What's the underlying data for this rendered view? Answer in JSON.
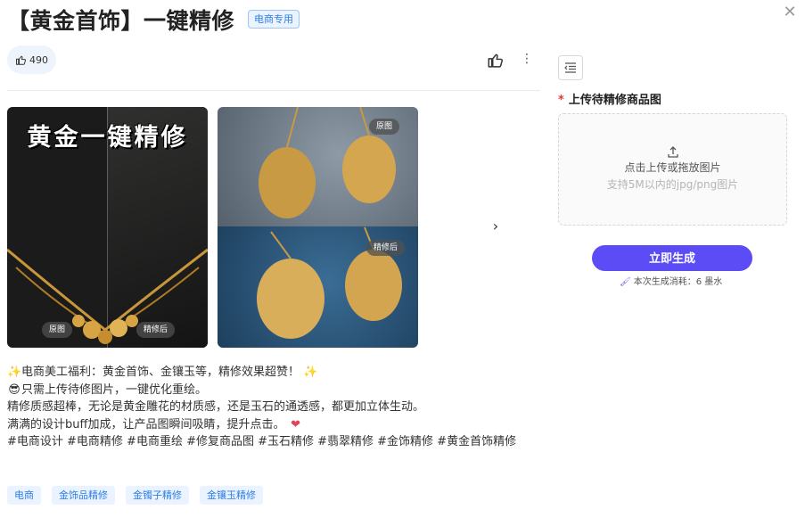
{
  "header": {
    "title": "【黄金首饰】一键精修",
    "badge": "电商专用",
    "close_icon": "close-icon"
  },
  "actions": {
    "like_count": "490",
    "like_icon": "thumbs-up-icon",
    "more_icon": "more-vertical-icon"
  },
  "gallery": {
    "image1": {
      "title": "黄金一键精修",
      "label_before": "原图",
      "label_after": "精修后"
    },
    "image2": {
      "label_before": "原图",
      "label_after": "精修后"
    },
    "next_icon": "chevron-right-icon"
  },
  "description": {
    "line1": "电商美工福利：黄金首饰、金镶玉等，精修效果超赞！",
    "line2": "只需上传待修图片，一键优化重绘。",
    "line3": "精修质感超棒，无论是黄金雕花的材质感，还是玉石的通透感，都更加立体生动。",
    "line4": "满满的设计buff加成，让产品图瞬间吸睛，提升点击。",
    "line5": "#电商设计 #电商精修 #电商重绘 #修复商品图 #玉石精修 #翡翠精修 #金饰精修 #黄金首饰精修"
  },
  "tags": [
    "电商",
    "金饰品精修",
    "金镯子精修",
    "金镶玉精修"
  ],
  "panel": {
    "collapse_icon": "indent-icon",
    "required_mark": "*",
    "upload_label": "上传待精修商品图",
    "upload_main": "点击上传或拖放图片",
    "upload_hint": "支持5M以内的jpg/png图片",
    "upload_icon": "upload-icon",
    "generate_button": "立即生成",
    "cost_text": "本次生成消耗：6 墨水"
  },
  "colors": {
    "accent": "#5b4cf5",
    "tag_blue": "#2f7fe0",
    "tag_bg": "#eaf3ff"
  }
}
